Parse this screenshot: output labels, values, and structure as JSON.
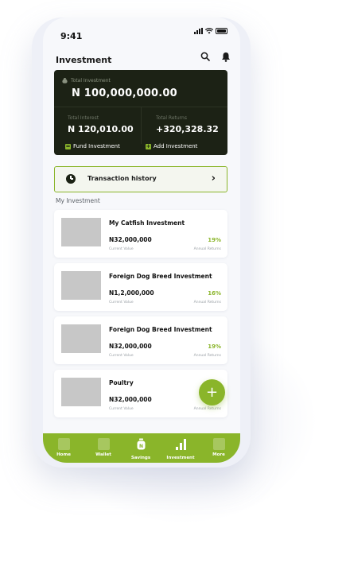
{
  "status_bar": {
    "time": "9:41"
  },
  "header": {
    "title": "Investment"
  },
  "summary": {
    "total_investment_label": "Total Investment",
    "total_investment_value": "N 100,000,000.00",
    "total_interest_label": "Total Interest",
    "total_interest_value": "N 120,010.00",
    "total_returns_label": "Total Returns",
    "total_returns_value": "+320,328.32",
    "fund_label": "Fund Investment",
    "add_label": "Add Investment"
  },
  "transaction": {
    "label": "Transaction  history"
  },
  "section_title": "My Investment",
  "investments": [
    {
      "title": "My Catfish Investment",
      "amount": "N32,000,000",
      "amount_caption": "Current Value",
      "pct": "19%",
      "pct_caption": "Annual Returns"
    },
    {
      "title": "Foreign Dog Breed Investment",
      "amount": "N1,2,000,000",
      "amount_caption": "Current Value",
      "pct": "16%",
      "pct_caption": "Annual Returns"
    },
    {
      "title": "Foreign Dog Breed Investment",
      "amount": "N32,000,000",
      "amount_caption": "Current Value",
      "pct": "19%",
      "pct_caption": "Annual Returns"
    },
    {
      "title": "Poultry",
      "amount": "N32,000,000",
      "amount_caption": "Current Value",
      "pct": "",
      "pct_caption": "Annual Returns"
    }
  ],
  "fab": {
    "icon": "+"
  },
  "nav": [
    {
      "label": "Home"
    },
    {
      "label": "Wallet"
    },
    {
      "label": "Savings",
      "icon_text": "N"
    },
    {
      "label": "Investment"
    },
    {
      "label": "More"
    }
  ],
  "colors": {
    "accent": "#8ab52a",
    "card_dark": "#1c2215",
    "background": "#f7f8fb"
  }
}
